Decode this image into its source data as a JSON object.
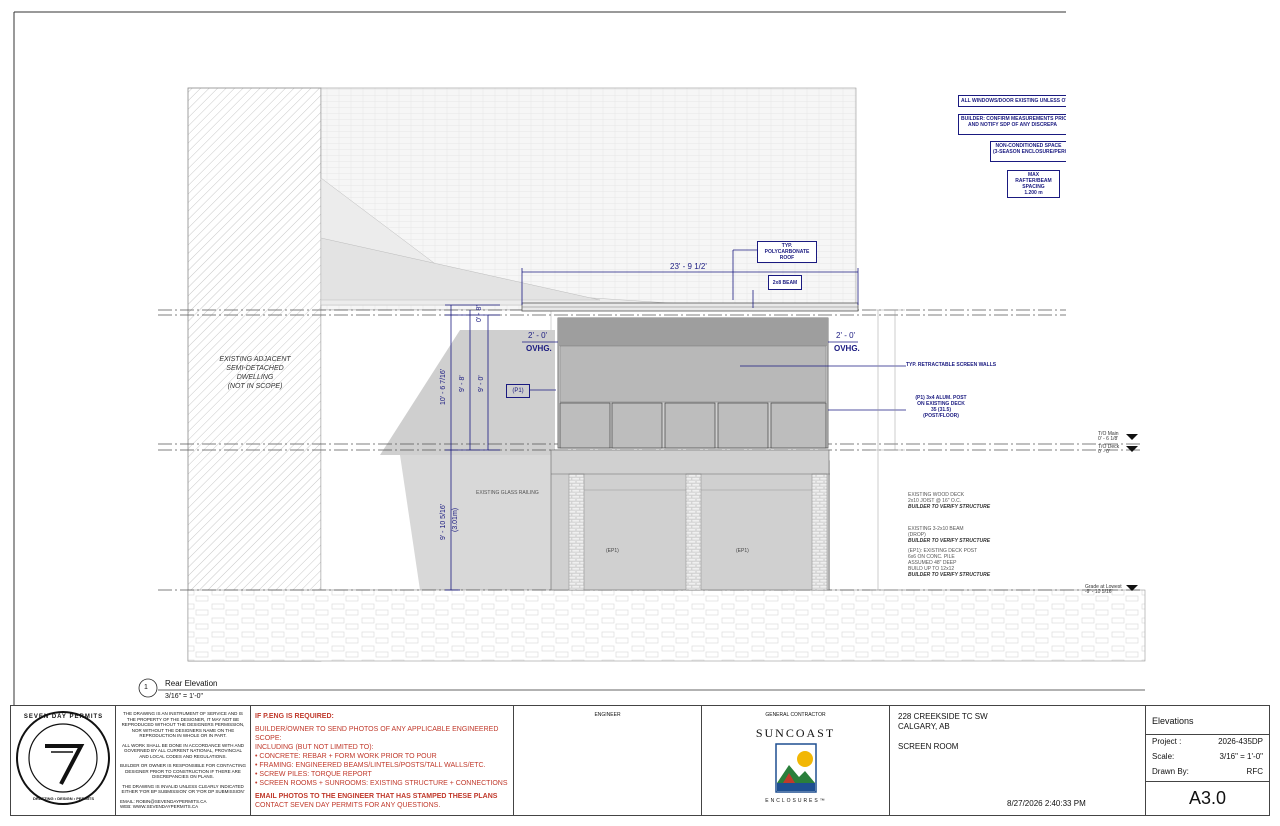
{
  "drawing": {
    "adjacent_label": [
      "EXISTING ADJACENT",
      "SEMI-DETACHED",
      "DWELLING",
      "(NOT IN SCOPE)"
    ],
    "dim_top": "23' - 9 1/2'",
    "dim_left_ovhg": "2' - 0'",
    "dim_right_ovhg": "2' - 0'",
    "ovhg": "OVHG.",
    "dim_0_8": "0' - 8'",
    "dim_10_6": "10' - 6 7/16'",
    "dim_9_8": "9' - 8'",
    "dim_9_0": "9' - 0'",
    "dim_lower": "9' - 10 5/16'",
    "dim_lower_m": "(3.01m)",
    "p1_tag": "(P1)",
    "ep1_tag_left": "(EP1)",
    "ep1_tag_right": "(EP1)",
    "glass_railing": "EXISTING GLASS RAILING",
    "callouts": {
      "polycarbonate": [
        "TYP. POLYCARBONATE",
        "ROOF"
      ],
      "beam": "2x8 BEAM",
      "retractable": "TYP. RETRACTABLE SCREEN WALLS",
      "post": [
        "(P1) 3x4 ALUM. POST",
        "ON EXISTING DECK",
        "35 (31.5)",
        "(POST/FLOOR)"
      ]
    },
    "notes": {
      "windows": "ALL WINDOWS/DOOR EXISTING UNLESS OTH",
      "builder": [
        "BUILDER: CONFIRM MEASUREMENTS PRIOR TO",
        "AND NOTIFY SDP OF ANY DISCREPA"
      ],
      "nonconditioned": [
        "NON-CONDITIONED SPACE",
        "(3-SEASON ENCLOSURE/PERGO"
      ],
      "rafter": [
        "MAX RAFTER/BEAM",
        "SPACING",
        "1.200 m"
      ]
    },
    "right_notes": [
      {
        "lines": [
          "EXISTING WOOD DECK",
          "2x10 JOIST @ 16\" O.C."
        ],
        "verify": "BUILDER TO VERIFY STRUCTURE"
      },
      {
        "lines": [
          "EXISTING 3-2x10 BEAM",
          "(DROP)"
        ],
        "verify": "BUILDER TO VERIFY STRUCTURE"
      },
      {
        "lines": [
          "(EP1): EXISTING DECK POST",
          "6x6 ON CONC. PILE",
          "ASSUMED 48\" DEEP",
          "BUILD UP TO 12x12"
        ],
        "verify": "BUILDER TO VERIFY STRUCTURE"
      }
    ],
    "levels": {
      "tio_main": [
        "T/O Main",
        "0' - 6 1/8'"
      ],
      "tio_deck": [
        "T/O Deck",
        "0' - 0'"
      ],
      "grade": [
        "Grade at Lowest",
        "-9' - 10 5/16'"
      ]
    },
    "view_number": "1",
    "view_title": "Rear Elevation",
    "view_scale": "3/16\" = 1'-0\""
  },
  "title_block": {
    "logo_text": "SEVEN DAY PERMITS",
    "logo_sub": "DRAFTING • DESIGN • PERMITS",
    "disclaimer1": "THE DRAWING IS AN INSTRUMENT OF SERVICE AND IS THE PROPERTY OF THE DESIGNER, IT MAY NOT BE REPRODUCED WITHOUT THE DESIGNERS PERMISSION, NOR WITHOUT THE DESIGNERS NAME ON THE REPRODUCTION IN WHOLE OR IN PART.",
    "disclaimer2": "ALL WORK SHALL BE DONE IN ACCORDANCE WITH AND GOVERNED BY ALL CURRENT NATIONAL, PROVINCIAL AND LOCAL CODES AND REGULATIONS.",
    "disclaimer3": "BUILDER OR OWNER IS RESPONSIBLE FOR CONTACTING DESIGNER PRIOR TO CONSTRUCTION IF THERE ARE DISCREPANCIES ON PLANS.",
    "disclaimer4": "THE DRAWING IS INVALID UNLESS CLEARLY INDICATED EITHER 'FOR BP SUBMISSION' OR 'FOR DP SUBMISSION'",
    "email": "EMAIL: ROBIN@SEVENDAYPERMITS.CA",
    "web": "WEB: WWW.SEVENDAYPERMITS.CA",
    "peng_title": "IF P.ENG IS REQUIRED:",
    "peng_lines": [
      "BUILDER/OWNER TO SEND PHOTOS OF ANY APPLICABLE ENGINEERED SCOPE:",
      "INCLUDING (BUT NOT LIMITED TO):",
      "• CONCRETE: REBAR + FORM WORK PRIOR TO POUR",
      "• FRAMING: ENGINEERED BEAMS/LINTELS/POSTS/TALL WALLS/ETC.",
      "• SCREW PILES: TORQUE REPORT",
      "• SCREEN ROOMS + SUNROOMS: EXISTING STRUCTURE + CONNECTIONS"
    ],
    "peng_email": "EMAIL PHOTOS TO THE ENGINEER THAT HAS STAMPED THESE PLANS",
    "peng_contact": "CONTACT SEVEN DAY PERMITS FOR ANY QUESTIONS.",
    "engineer_label": "ENGINEER",
    "gc_label": "GENERAL CONTRACTOR",
    "gc_name": "SUNCOAST",
    "gc_sub": "ENCLOSURES™",
    "address1": "228 CREEKSIDE TC SW",
    "address2": "CALGARY, AB",
    "scope": "SCREEN ROOM",
    "timestamp": "8/27/2026 2:40:33 PM",
    "sheet_title": "Elevations",
    "project_label": "Project :",
    "project_value": "2026-435DP",
    "scale_label": "Scale:",
    "scale_value": "3/16\" = 1'-0\"",
    "drawn_label": "Drawn By:",
    "drawn_value": "RFC",
    "sheet_number": "A3.0"
  },
  "colors": {
    "ink": "#1a1a80",
    "annot_red": "#c0392b",
    "roof_gray": "#f2f2f2",
    "shadow_gray": "#c9c9c9",
    "screen_gray": "#b5b5b5"
  }
}
